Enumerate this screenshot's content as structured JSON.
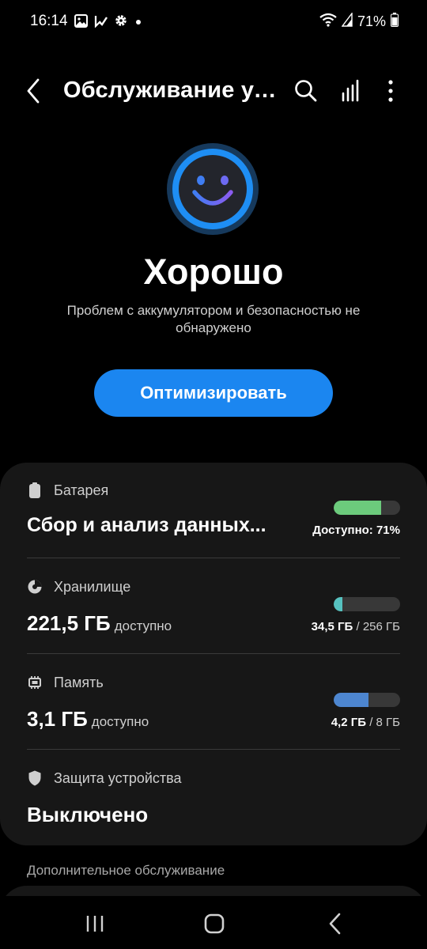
{
  "status_bar": {
    "time": "16:14",
    "battery_percent": "71%",
    "left_icons": [
      "image-icon",
      "check-icon",
      "gear-icon",
      "dot-icon"
    ],
    "right_icons": [
      "wifi-icon",
      "signal-icon",
      "battery-icon"
    ]
  },
  "header": {
    "title": "Обслуживание устройства",
    "icons": [
      "back-icon",
      "search-icon",
      "bar-chart-icon",
      "more-vert-icon"
    ]
  },
  "hero": {
    "icon": "smiley-face-icon",
    "status": "Хорошо",
    "description": "Проблем с аккумулятором и безопасностью не обнаружено",
    "optimize_label": "Оптимизировать"
  },
  "sections": {
    "battery": {
      "label": "Батарея",
      "value": "Сбор и анализ данных...",
      "caption": "Доступно: 71%",
      "level": 0.71,
      "bar_color": "#6ccb7c",
      "icon": "battery-icon"
    },
    "storage": {
      "label": "Хранилище",
      "value": "221,5 ГБ",
      "value_suffix": "доступно",
      "used": "34,5 ГБ",
      "total": "/ 256 ГБ",
      "level": 0.135,
      "bar_color": "#56c2c0",
      "icon": "pie-chart-icon"
    },
    "memory": {
      "label": "Память",
      "value": "3,1 ГБ",
      "value_suffix": "доступно",
      "used": "4,2 ГБ",
      "total": "/ 8 ГБ",
      "level": 0.525,
      "bar_color": "#4d86d0",
      "icon": "memory-chip-icon"
    },
    "security": {
      "label": "Защита устройства",
      "value": "Выключено",
      "icon": "shield-icon"
    }
  },
  "extra": {
    "label": "Дополнительное обслуживание"
  },
  "nav": {
    "icons": [
      "recents-icon",
      "home-icon",
      "back-icon"
    ]
  },
  "colors": {
    "accent": "#1b86f0",
    "card_bg": "#171717",
    "background": "#000000"
  }
}
